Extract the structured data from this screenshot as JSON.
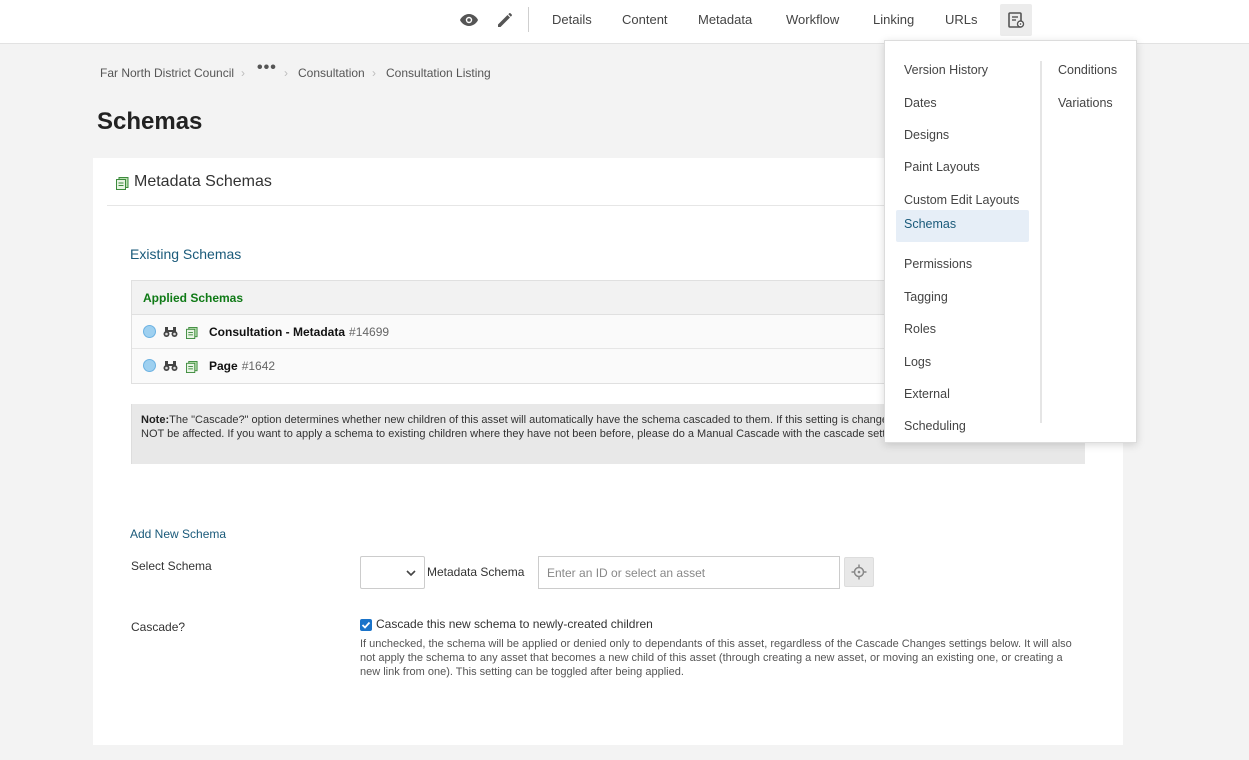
{
  "topbar": {
    "icons": [
      "eye-icon",
      "pencil-icon",
      "settings-panel-icon"
    ],
    "tabs": [
      "Details",
      "Content",
      "Metadata",
      "Workflow",
      "Linking",
      "URLs"
    ]
  },
  "breadcrumb": {
    "items": [
      "Far North District Council",
      "Consultation",
      "Consultation Listing"
    ],
    "ellipsis": "•••",
    "separator": "›"
  },
  "page": {
    "title": "Schemas"
  },
  "section": {
    "title": "Metadata Schemas"
  },
  "existing": {
    "title": "Existing Schemas",
    "table_header": "Applied Schemas",
    "rows": [
      {
        "name": "Consultation - Metadata",
        "id": "#14699"
      },
      {
        "name": "Page",
        "id": "#1642"
      }
    ]
  },
  "note": {
    "label": "Note:",
    "text": "The \"Cascade?\" option determines whether new children of this asset will automatically have the schema cascaded to them. If this setting is changed, existing dependant children will NOT be affected. If you want to apply a schema to existing children where they have not been before, please do a Manual Cascade with the cascade setting on."
  },
  "add_schema": {
    "title": "Add New Schema",
    "select_label": "Select Schema",
    "metadata_label": "Metadata Schema",
    "asset_placeholder": "Enter an ID or select an asset",
    "cascade_label": "Cascade?",
    "cascade_checked": true,
    "cascade_checkbox_label": "Cascade this new schema to newly-created children",
    "cascade_help": "If unchecked, the schema will be applied or denied only to dependants of this asset, regardless of the Cascade Changes settings below. It will also not apply the schema to any asset that becomes a new child of this asset (through creating a new asset, or moving an existing one, or creating a new link from one). This setting can be toggled after being applied."
  },
  "menu": {
    "col1": [
      "Version History",
      "Dates",
      "Designs",
      "Paint Layouts",
      "Custom Edit Layouts",
      "Schemas",
      "Permissions",
      "Tagging",
      "Roles",
      "Logs",
      "External",
      "Scheduling"
    ],
    "col2": [
      "Conditions",
      "Variations"
    ],
    "active": "Schemas"
  },
  "colors": {
    "applied_header": "#0f7a16",
    "link": "#1a5a7a",
    "active_menu_bg": "#e6eef7",
    "status_dot": "#9ed0f0"
  }
}
